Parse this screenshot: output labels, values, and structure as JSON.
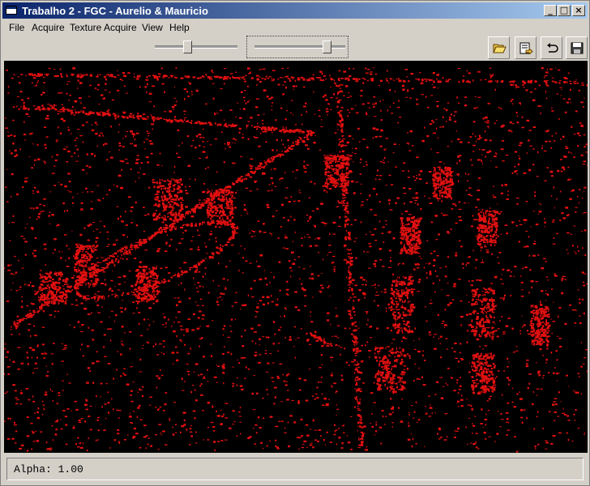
{
  "window": {
    "title": "Trabalho 2 - FGC - Aurelio & Mauricio"
  },
  "menu": [
    "File",
    "Acquire",
    "Texture Acquire",
    "View",
    "Help"
  ],
  "window_buttons": {
    "minimize": "_",
    "maximize": "□",
    "close": "×"
  },
  "toolbar": {
    "slider1_level": 0.38,
    "slider2_level": 0.83,
    "buttons": [
      "open-folder-icon",
      "export-icon",
      "undo-icon",
      "save-icon"
    ]
  },
  "colors": {
    "image_bg": "#000000",
    "image_edges": "#e01010",
    "titlebar_start": "#0a246a",
    "titlebar_end": "#a6caf0",
    "chrome": "#d4d0c8"
  },
  "status": {
    "text": "Alpha: 1.00"
  }
}
